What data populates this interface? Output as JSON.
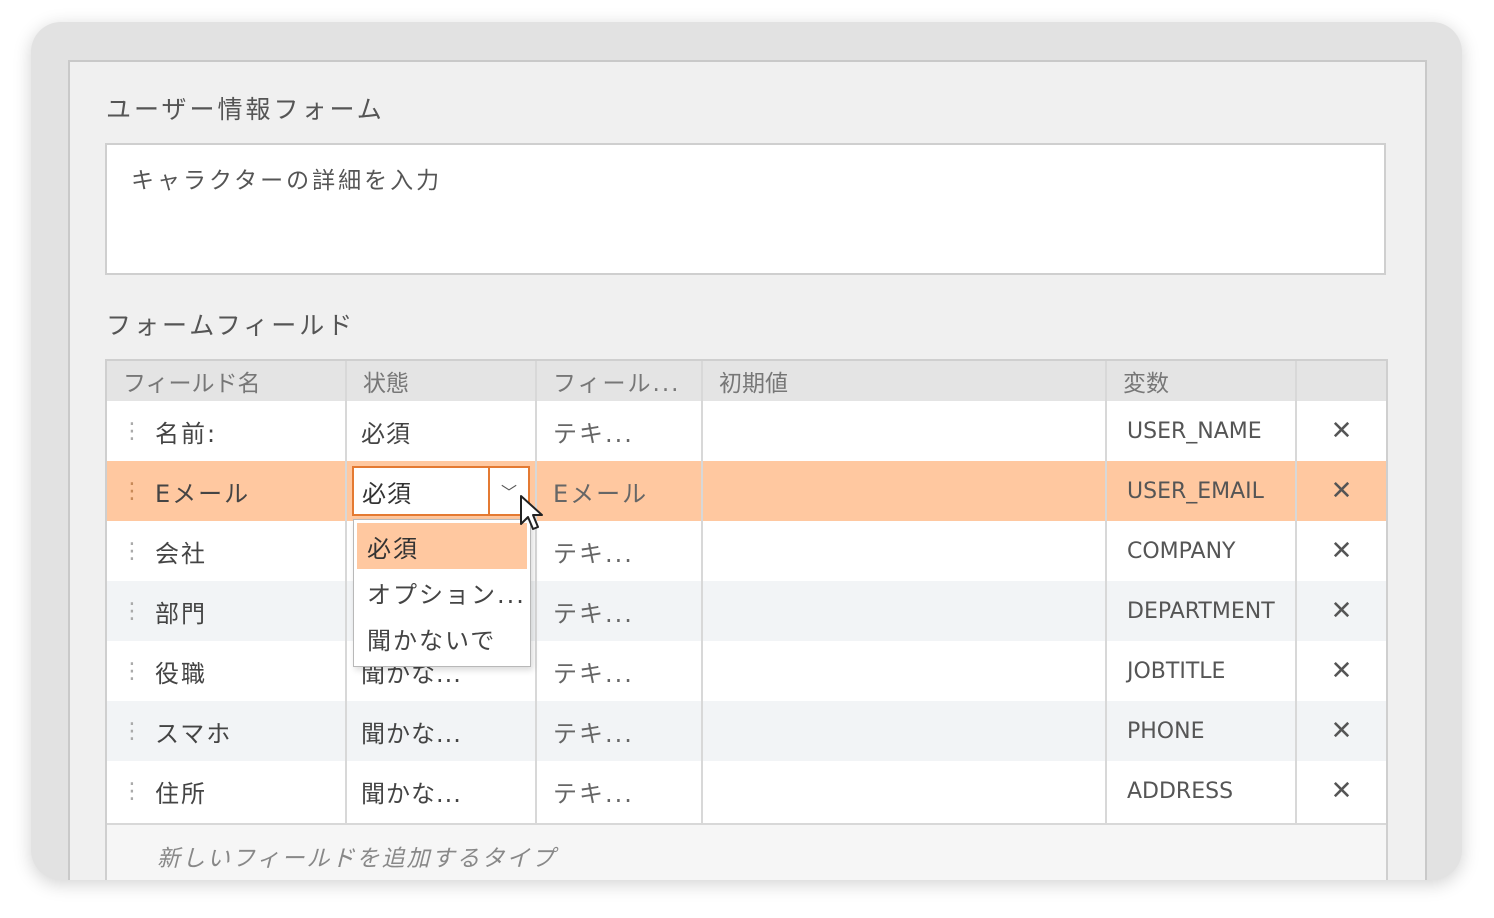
{
  "form": {
    "title": "ユーザー情報フォーム",
    "description": "キャラクターの詳細を入力",
    "fields_label": "フォームフィールド"
  },
  "table": {
    "headers": {
      "name": "フィールド名",
      "status": "状態",
      "type": "フィール...",
      "initial": "初期値",
      "variable": "変数"
    },
    "rows": [
      {
        "name": "名前:",
        "status": "必須",
        "type": "テキ...",
        "initial": "",
        "variable": "USER_NAME"
      },
      {
        "name": "Eメール",
        "status": "必須",
        "type": "Eメール",
        "initial": "",
        "variable": "USER_EMAIL"
      },
      {
        "name": "会社",
        "status": "",
        "type": "テキ...",
        "initial": "",
        "variable": "COMPANY"
      },
      {
        "name": "部門",
        "status": "",
        "type": "テキ...",
        "initial": "",
        "variable": "DEPARTMENT"
      },
      {
        "name": "役職",
        "status": "聞かな...",
        "type": "テキ...",
        "initial": "",
        "variable": "JOBTITLE"
      },
      {
        "name": "スマホ",
        "status": "聞かな...",
        "type": "テキ...",
        "initial": "",
        "variable": "PHONE"
      },
      {
        "name": "住所",
        "status": "聞かな...",
        "type": "テキ...",
        "initial": "",
        "variable": "ADDRESS"
      }
    ],
    "add_placeholder": "新しいフィールドを追加するタイプ",
    "delete_symbol": "✕",
    "drag_handle_symbol": "⋮"
  },
  "dropdown": {
    "selected": "必須",
    "chevron": "﹀",
    "options": [
      "必須",
      "オプション...",
      "聞かないで"
    ]
  },
  "colors": {
    "selected_row": "#ffc8a0",
    "accent": "#e47a32"
  },
  "icons": {
    "delete": "close-icon",
    "drag": "drag-handle-icon",
    "dropdown": "chevron-down-icon",
    "cursor": "mouse-pointer-icon"
  }
}
